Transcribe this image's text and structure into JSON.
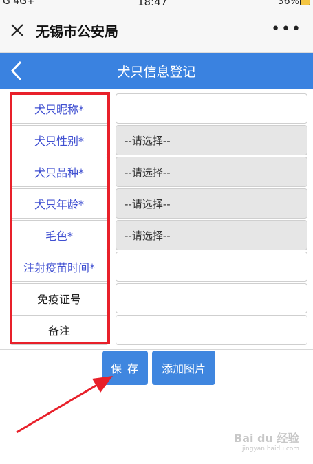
{
  "status_bar": {
    "left": "G  4G+",
    "time": "18:47",
    "right": "36%"
  },
  "app_bar": {
    "title": "无锡市公安局",
    "more": "•••"
  },
  "header": {
    "title": "犬只信息登记"
  },
  "form": {
    "rows": [
      {
        "label": "犬只昵称*",
        "value": "",
        "type": "input"
      },
      {
        "label": "犬只性别*",
        "value": "--请选择--",
        "type": "select"
      },
      {
        "label": "犬只品种*",
        "value": "--请选择--",
        "type": "select"
      },
      {
        "label": "犬只年龄*",
        "value": "--请选择--",
        "type": "select"
      },
      {
        "label": "毛色*",
        "value": "--请选择--",
        "type": "select"
      },
      {
        "label": "注射疫苗时间*",
        "value": "",
        "type": "input"
      },
      {
        "label": "免疫证号",
        "value": "",
        "type": "input"
      },
      {
        "label": "备注",
        "value": "",
        "type": "input"
      }
    ]
  },
  "actions": {
    "save_label": "保存",
    "add_image_label": "添加图片"
  },
  "watermark": {
    "text": "Bai du 经验",
    "sub": "jingyan.baidu.com"
  },
  "colors": {
    "header_blue": "#3a82e0",
    "button_blue": "#3f86df",
    "required_label": "#3f4fd1",
    "highlight_red": "#e8202a"
  }
}
